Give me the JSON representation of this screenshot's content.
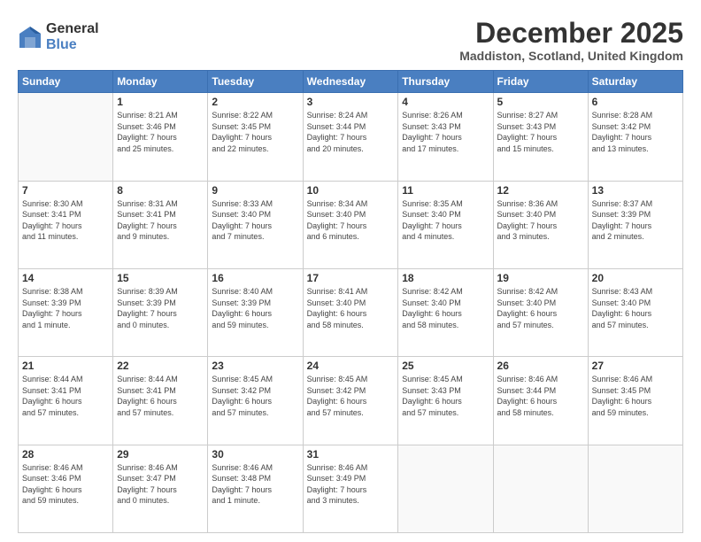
{
  "header": {
    "logo_general": "General",
    "logo_blue": "Blue",
    "month_title": "December 2025",
    "location": "Maddiston, Scotland, United Kingdom"
  },
  "calendar": {
    "days_of_week": [
      "Sunday",
      "Monday",
      "Tuesday",
      "Wednesday",
      "Thursday",
      "Friday",
      "Saturday"
    ],
    "weeks": [
      [
        {
          "day": "",
          "detail": ""
        },
        {
          "day": "1",
          "detail": "Sunrise: 8:21 AM\nSunset: 3:46 PM\nDaylight: 7 hours\nand 25 minutes."
        },
        {
          "day": "2",
          "detail": "Sunrise: 8:22 AM\nSunset: 3:45 PM\nDaylight: 7 hours\nand 22 minutes."
        },
        {
          "day": "3",
          "detail": "Sunrise: 8:24 AM\nSunset: 3:44 PM\nDaylight: 7 hours\nand 20 minutes."
        },
        {
          "day": "4",
          "detail": "Sunrise: 8:26 AM\nSunset: 3:43 PM\nDaylight: 7 hours\nand 17 minutes."
        },
        {
          "day": "5",
          "detail": "Sunrise: 8:27 AM\nSunset: 3:43 PM\nDaylight: 7 hours\nand 15 minutes."
        },
        {
          "day": "6",
          "detail": "Sunrise: 8:28 AM\nSunset: 3:42 PM\nDaylight: 7 hours\nand 13 minutes."
        }
      ],
      [
        {
          "day": "7",
          "detail": "Sunrise: 8:30 AM\nSunset: 3:41 PM\nDaylight: 7 hours\nand 11 minutes."
        },
        {
          "day": "8",
          "detail": "Sunrise: 8:31 AM\nSunset: 3:41 PM\nDaylight: 7 hours\nand 9 minutes."
        },
        {
          "day": "9",
          "detail": "Sunrise: 8:33 AM\nSunset: 3:40 PM\nDaylight: 7 hours\nand 7 minutes."
        },
        {
          "day": "10",
          "detail": "Sunrise: 8:34 AM\nSunset: 3:40 PM\nDaylight: 7 hours\nand 6 minutes."
        },
        {
          "day": "11",
          "detail": "Sunrise: 8:35 AM\nSunset: 3:40 PM\nDaylight: 7 hours\nand 4 minutes."
        },
        {
          "day": "12",
          "detail": "Sunrise: 8:36 AM\nSunset: 3:40 PM\nDaylight: 7 hours\nand 3 minutes."
        },
        {
          "day": "13",
          "detail": "Sunrise: 8:37 AM\nSunset: 3:39 PM\nDaylight: 7 hours\nand 2 minutes."
        }
      ],
      [
        {
          "day": "14",
          "detail": "Sunrise: 8:38 AM\nSunset: 3:39 PM\nDaylight: 7 hours\nand 1 minute."
        },
        {
          "day": "15",
          "detail": "Sunrise: 8:39 AM\nSunset: 3:39 PM\nDaylight: 7 hours\nand 0 minutes."
        },
        {
          "day": "16",
          "detail": "Sunrise: 8:40 AM\nSunset: 3:39 PM\nDaylight: 6 hours\nand 59 minutes."
        },
        {
          "day": "17",
          "detail": "Sunrise: 8:41 AM\nSunset: 3:40 PM\nDaylight: 6 hours\nand 58 minutes."
        },
        {
          "day": "18",
          "detail": "Sunrise: 8:42 AM\nSunset: 3:40 PM\nDaylight: 6 hours\nand 58 minutes."
        },
        {
          "day": "19",
          "detail": "Sunrise: 8:42 AM\nSunset: 3:40 PM\nDaylight: 6 hours\nand 57 minutes."
        },
        {
          "day": "20",
          "detail": "Sunrise: 8:43 AM\nSunset: 3:40 PM\nDaylight: 6 hours\nand 57 minutes."
        }
      ],
      [
        {
          "day": "21",
          "detail": "Sunrise: 8:44 AM\nSunset: 3:41 PM\nDaylight: 6 hours\nand 57 minutes."
        },
        {
          "day": "22",
          "detail": "Sunrise: 8:44 AM\nSunset: 3:41 PM\nDaylight: 6 hours\nand 57 minutes."
        },
        {
          "day": "23",
          "detail": "Sunrise: 8:45 AM\nSunset: 3:42 PM\nDaylight: 6 hours\nand 57 minutes."
        },
        {
          "day": "24",
          "detail": "Sunrise: 8:45 AM\nSunset: 3:42 PM\nDaylight: 6 hours\nand 57 minutes."
        },
        {
          "day": "25",
          "detail": "Sunrise: 8:45 AM\nSunset: 3:43 PM\nDaylight: 6 hours\nand 57 minutes."
        },
        {
          "day": "26",
          "detail": "Sunrise: 8:46 AM\nSunset: 3:44 PM\nDaylight: 6 hours\nand 58 minutes."
        },
        {
          "day": "27",
          "detail": "Sunrise: 8:46 AM\nSunset: 3:45 PM\nDaylight: 6 hours\nand 59 minutes."
        }
      ],
      [
        {
          "day": "28",
          "detail": "Sunrise: 8:46 AM\nSunset: 3:46 PM\nDaylight: 6 hours\nand 59 minutes."
        },
        {
          "day": "29",
          "detail": "Sunrise: 8:46 AM\nSunset: 3:47 PM\nDaylight: 7 hours\nand 0 minutes."
        },
        {
          "day": "30",
          "detail": "Sunrise: 8:46 AM\nSunset: 3:48 PM\nDaylight: 7 hours\nand 1 minute."
        },
        {
          "day": "31",
          "detail": "Sunrise: 8:46 AM\nSunset: 3:49 PM\nDaylight: 7 hours\nand 3 minutes."
        },
        {
          "day": "",
          "detail": ""
        },
        {
          "day": "",
          "detail": ""
        },
        {
          "day": "",
          "detail": ""
        }
      ]
    ]
  }
}
